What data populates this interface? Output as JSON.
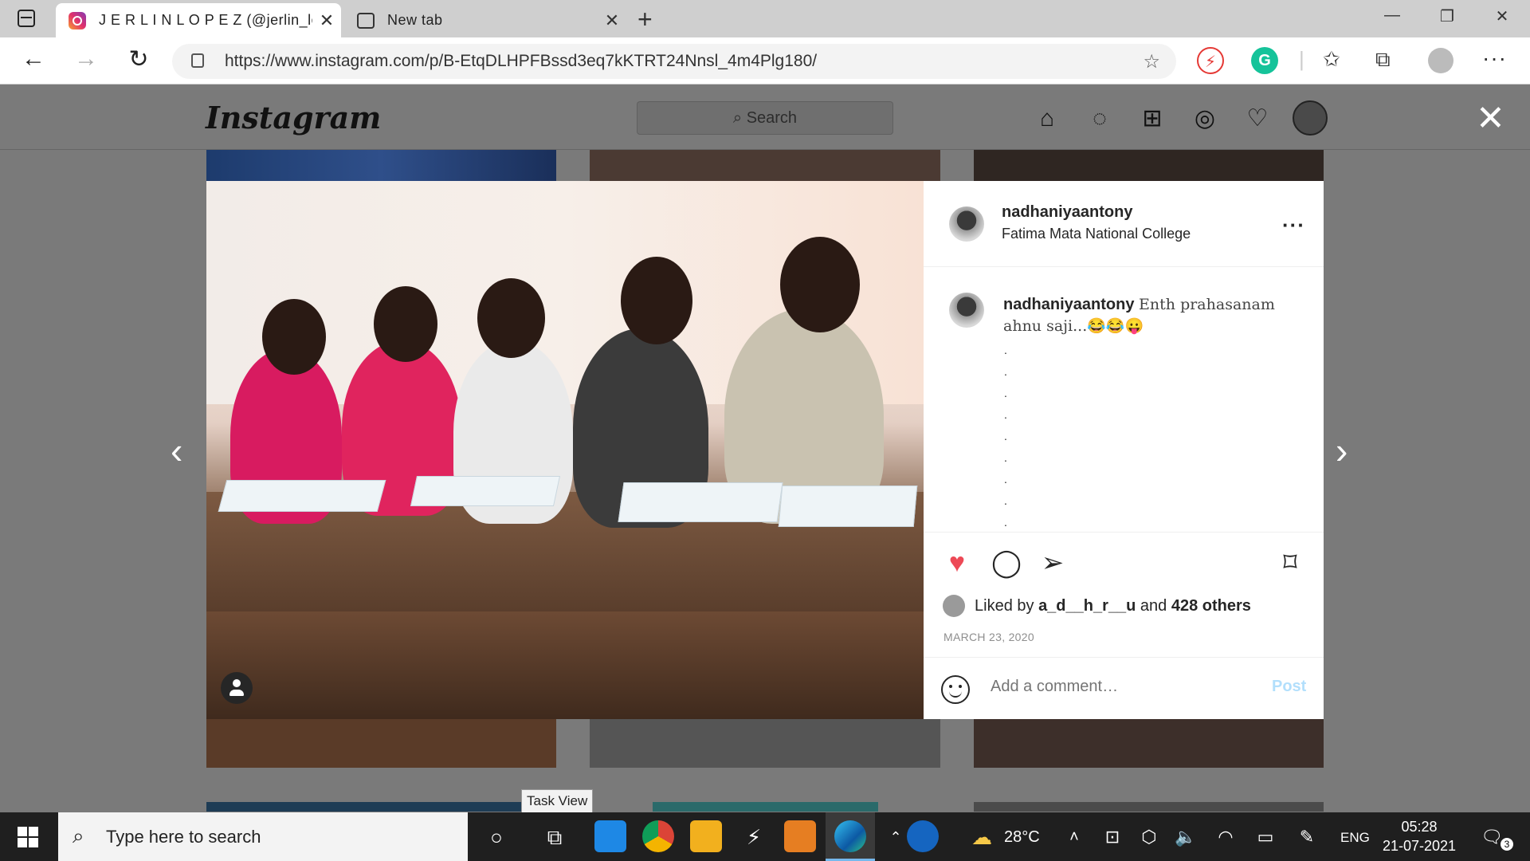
{
  "browser": {
    "tabs": [
      {
        "title": "J E R L I N L O P E Z (@jerlin_lopez",
        "active": true,
        "icon": "instagram-icon"
      },
      {
        "title": "New tab",
        "active": false,
        "icon": "newtab-icon"
      }
    ],
    "url": "https://www.instagram.com/p/B-EtqDLHPFBssd3eq7kKTRT24Nnsl_4m4Plg180/"
  },
  "instagram": {
    "logo": "Instagram",
    "search_placeholder": "Search",
    "nav_icons": [
      "home-icon",
      "messenger-icon",
      "new-post-icon",
      "explore-icon",
      "activity-heart-icon",
      "profile-avatar"
    ]
  },
  "post": {
    "username": "nadhaniyaantony",
    "location": "Fatima Mata National College",
    "caption_user": "nadhaniyaantony",
    "caption_text": "Enth prahasanam ahnu saji...😂😂😛",
    "caption_dots": [
      ".",
      ".",
      ".",
      ".",
      ".",
      ".",
      ".",
      ".",
      "."
    ],
    "liked_by_prefix": "Liked by",
    "liked_by_user": "a_d__h_r__u",
    "liked_by_and": "and",
    "liked_by_others": "428 others",
    "date": "MARCH 23, 2020",
    "comment_placeholder": "Add a comment…",
    "post_label": "Post",
    "liked": true
  },
  "tooltip": "Task View",
  "taskbar": {
    "search_placeholder": "Type here to search",
    "weather": "28°C",
    "language": "ENG",
    "time": "05:28",
    "date": "21-07-2021",
    "notification_count": "3"
  },
  "colors": {
    "like_red": "#ed4956",
    "post_blue_disabled": "#b2dffc",
    "taskbar_bg": "#1f1f1f",
    "overlay_gray": "#7a7a7a"
  }
}
